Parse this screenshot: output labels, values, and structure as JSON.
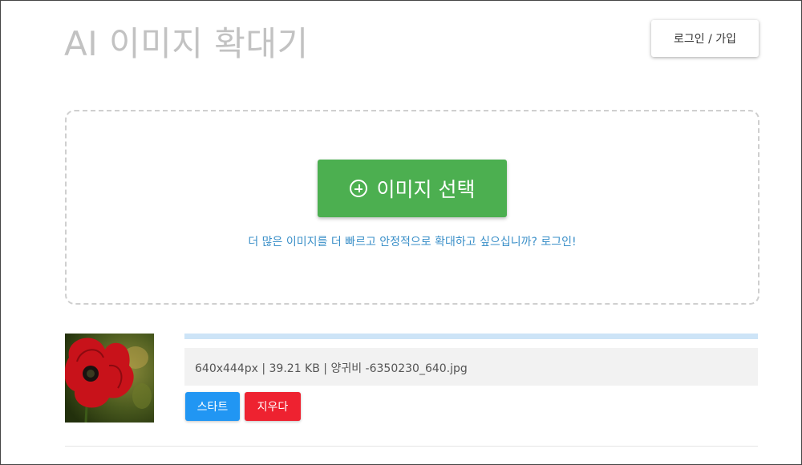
{
  "header": {
    "title": "AI 이미지 확대기",
    "login_label": "로그인 / 가입"
  },
  "dropzone": {
    "select_label": "이미지 선택",
    "select_icon": "plus-circle-icon",
    "promo_text": "더 많은 이미지를 더 빠르고 안정적으로 확대하고 싶으십니까? 로그인!"
  },
  "file": {
    "info": "640x444px | 39.21 KB | 양귀비 -6350230_640.jpg",
    "start_label": "스타트",
    "delete_label": "지우다",
    "progress_fraction": 0
  },
  "colors": {
    "title": "#c2c2c2",
    "select_button": "#4caf50",
    "link": "#3a8fc8",
    "progress_track": "#cde4f7",
    "start_button": "#2196f3",
    "delete_button": "#ee2230"
  }
}
